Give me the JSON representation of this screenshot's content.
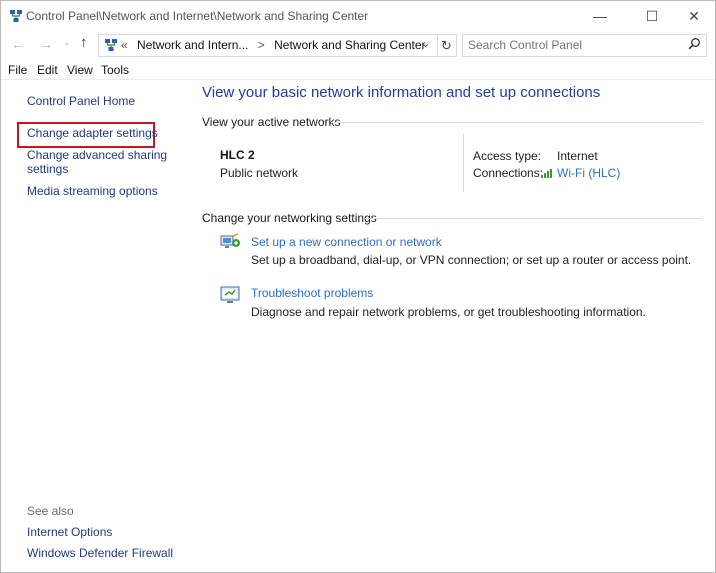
{
  "window": {
    "title": "Control Panel\\Network and Internet\\Network and Sharing Center",
    "minimize_glyph": "—",
    "maximize_glyph": "☐",
    "close_glyph": "✕"
  },
  "navigation": {
    "back_glyph": "←",
    "forward_glyph": "→",
    "recent_glyph": "⌄",
    "up_glyph": "↑",
    "address": {
      "overflow_glyph": "«",
      "crumbs": [
        "Network and Intern...",
        "Network and Sharing Center"
      ],
      "separator": ">",
      "dropdown_glyph": "⌄"
    },
    "refresh_glyph": "↻",
    "search": {
      "placeholder": "Search Control Panel",
      "value": ""
    }
  },
  "menu": {
    "items": [
      "File",
      "Edit",
      "View",
      "Tools"
    ]
  },
  "sidebar": {
    "home": "Control Panel Home",
    "links": [
      "Change adapter settings",
      "Change advanced sharing",
      "settings",
      "Media streaming options"
    ],
    "see_also_label": "See also",
    "see_also": [
      "Internet Options",
      "Windows Defender Firewall"
    ]
  },
  "main": {
    "title": "View your basic network information and set up connections",
    "active_networks_label": "View your active networks",
    "network": {
      "name": "HLC 2",
      "category": "Public network",
      "access_type_label": "Access type:",
      "access_type": "Internet",
      "connections_label": "Connections:",
      "connection": "Wi-Fi (HLC)"
    },
    "change_settings_label": "Change your networking settings",
    "tasks": [
      {
        "link": "Set up a new connection or network",
        "description": "Set up a broadband, dial-up, or VPN connection; or set up a router or access point."
      },
      {
        "link": "Troubleshoot problems",
        "description": "Diagnose and repair network problems, or get troubleshooting information."
      }
    ]
  },
  "colors": {
    "link": "#2a6fc9",
    "title": "#1e3f9a",
    "sidebar_link": "#1f3b80",
    "highlight_border": "#c4161c",
    "wifi_signal": "#3c9a3c"
  },
  "icons": {
    "title_icon": "network-icon",
    "address_icon": "network-icon",
    "search_icon": "magnifier-icon",
    "wifi_icon": "wifi-signal-icon",
    "task_setup_icon": "new-connection-icon",
    "task_troubleshoot_icon": "troubleshoot-icon"
  }
}
